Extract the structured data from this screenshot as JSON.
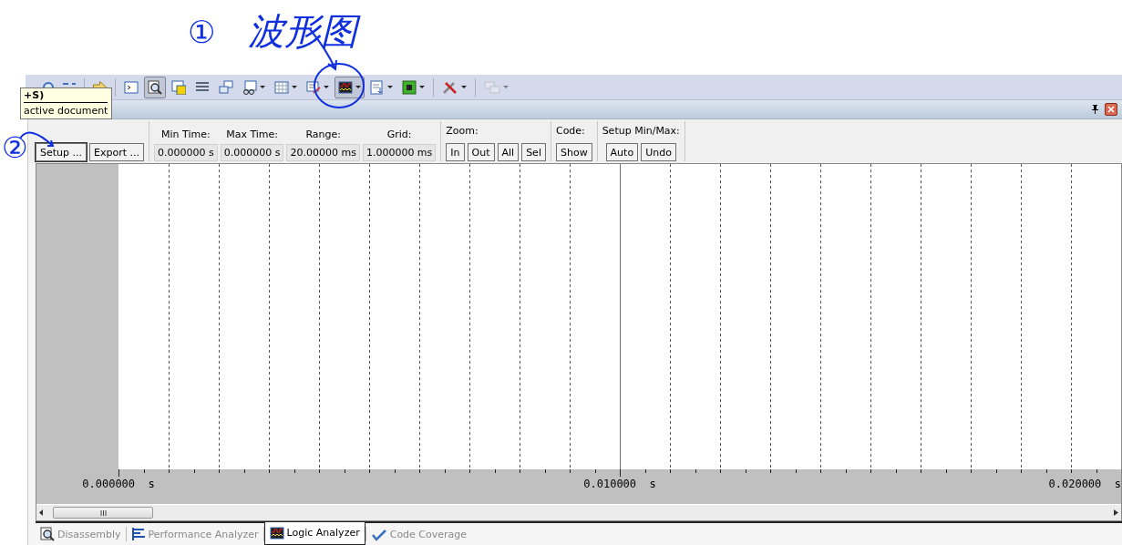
{
  "annotations": [
    {
      "number": "①",
      "label": "波形图"
    },
    {
      "number": "②"
    }
  ],
  "toolbar": {
    "buttons": [
      {
        "kind": "cut-icon",
        "dropdown": false,
        "pressed": false,
        "disabled": false
      },
      {
        "kind": "arrow",
        "dropdown": false,
        "pressed": false,
        "disabled": false
      },
      {
        "kind": "command",
        "dropdown": false,
        "pressed": false,
        "disabled": false
      },
      {
        "kind": "disassembly",
        "dropdown": false,
        "pressed": true,
        "disabled": false
      },
      {
        "kind": "symbols",
        "dropdown": false,
        "pressed": false,
        "disabled": false
      },
      {
        "kind": "registers",
        "dropdown": false,
        "pressed": false,
        "disabled": false
      },
      {
        "kind": "callstack",
        "dropdown": false,
        "pressed": false,
        "disabled": false
      },
      {
        "kind": "watch",
        "dropdown": true,
        "pressed": false,
        "disabled": false
      },
      {
        "kind": "memory",
        "dropdown": true,
        "pressed": false,
        "disabled": false
      },
      {
        "kind": "serial",
        "dropdown": true,
        "pressed": false,
        "disabled": false
      },
      {
        "kind": "analyzer",
        "dropdown": true,
        "pressed": true,
        "disabled": false
      },
      {
        "kind": "trace",
        "dropdown": true,
        "pressed": false,
        "disabled": false
      },
      {
        "kind": "chip",
        "dropdown": true,
        "pressed": false,
        "disabled": false
      },
      {
        "kind": "tools",
        "dropdown": true,
        "pressed": false,
        "disabled": false
      },
      {
        "kind": "window",
        "dropdown": true,
        "pressed": false,
        "disabled": true
      }
    ]
  },
  "tooltip": {
    "title": "+S)",
    "text": "active document"
  },
  "panel": {
    "buttons": [
      "Setup ...",
      "Export ..."
    ],
    "fields": [
      {
        "label": "Min Time:",
        "value": "0.000000 s"
      },
      {
        "label": "Max Time:",
        "value": "0.000000 s"
      },
      {
        "label": "Range:",
        "value": "20.00000 ms"
      },
      {
        "label": "Grid:",
        "value": "1.000000 ms"
      }
    ],
    "groups": [
      {
        "label": "Zoom:",
        "buttons": [
          "In",
          "Out",
          "All",
          "Sel"
        ]
      },
      {
        "label": "Code:",
        "buttons": [
          "Show"
        ]
      },
      {
        "label": "Setup Min/Max:",
        "buttons": [
          "Auto",
          "Undo"
        ]
      }
    ],
    "axis_labels": [
      "0.000000  s",
      "0.010000  s",
      "0.020000  s"
    ]
  },
  "tabs": [
    {
      "label": "Disassembly",
      "kind": "disassembly",
      "selected": false
    },
    {
      "label": "Performance Analyzer",
      "kind": "performance",
      "selected": false
    },
    {
      "label": "Logic Analyzer",
      "kind": "analyzer",
      "selected": true
    },
    {
      "label": "Code Coverage",
      "kind": "coverage",
      "selected": false
    }
  ]
}
